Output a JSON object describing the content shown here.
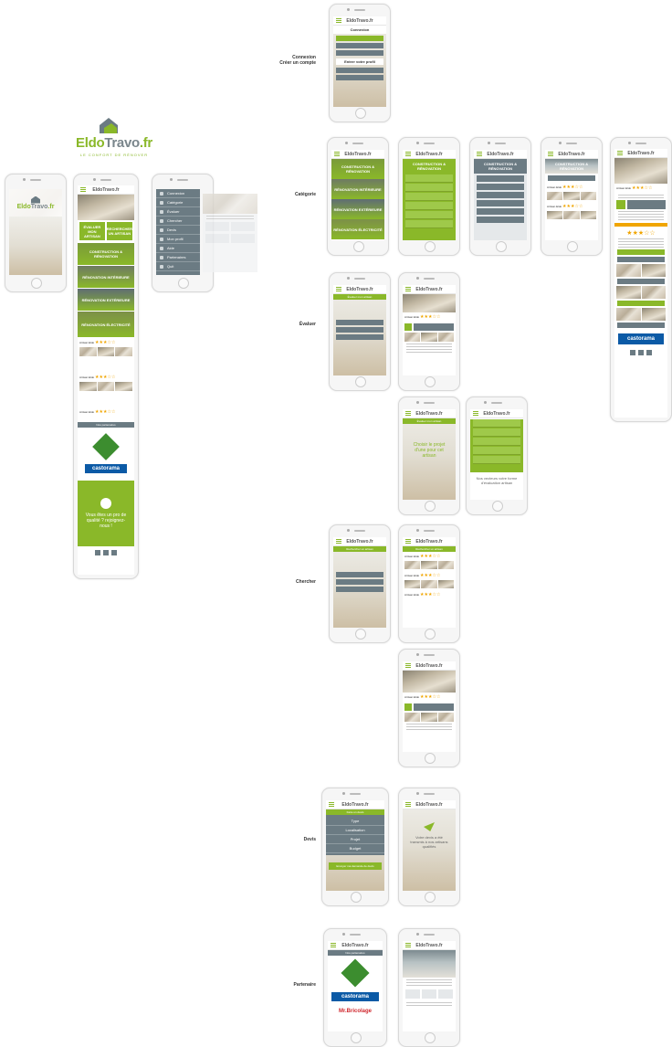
{
  "brand": {
    "logo_text_part1": "Eldo",
    "logo_text_part2": "Travo",
    "logo_text_suffix": ".fr",
    "tagline": "LE CONFORT DE RÉNOVER"
  },
  "app_header_title": "EldoTravo.fr",
  "section_labels": {
    "connexion": "Connexion",
    "creer_compte": "Créer un compte",
    "categorie": "Catégorie",
    "evaluer": "Évaluer",
    "chercher": "Chercher",
    "devis": "Devis",
    "partenaire": "Partenaire"
  },
  "connexion_screen": {
    "title": "Connexion",
    "button": "Entrer votre profil"
  },
  "home_screen": {
    "tiles": [
      "Construction & Rénovation",
      "Rénovation Intérieure",
      "Rénovation Extérieure",
      "Rénovation Électricité"
    ],
    "buttons": [
      "Évaluer mon artisan",
      "Rechercher un artisan"
    ],
    "partners_title": "Nos partenaires",
    "partners": [
      "LEROY MERLIN",
      "castorama"
    ],
    "cta": "Vous êtes un pro de qualité ? rejoignez-nous !"
  },
  "menu_screen": {
    "items": [
      "Connexion",
      "Catégorie",
      "Évaluer",
      "Chercher",
      "Devis",
      "Mon profil",
      "Aide",
      "Partenaires",
      "Quit"
    ]
  },
  "category_screen": {
    "tiles": [
      "Construction & Rénovation",
      "Rénovation Intérieure",
      "Rénovation Extérieure",
      "Rénovation Électricité"
    ]
  },
  "artisan": {
    "name": "Artisan Eldo",
    "rating_stars": "★★★☆☆"
  },
  "evaluer_screen": {
    "title": "Évaluer mon artisan",
    "empty_message": "Choisir le projet d'une pour cet artisan",
    "menu_footer": "Nos vecteurs votre forme d'évaluation artisan"
  },
  "chercher_screen": {
    "title": "Rechercher un artisan"
  },
  "devis_screen": {
    "title": "Faire un devis",
    "items": [
      "Type",
      "Localisation",
      "Projet",
      "Budget"
    ],
    "button": "Envoyer ma demande de devis",
    "confirm_message": "Votre devis a été transmis à nos artisans qualifiés"
  },
  "partenaire_screen": {
    "title": "Nos partenaires",
    "logos": [
      "LEROY MERLIN",
      "castorama",
      "Mr.Bricolage"
    ]
  },
  "detail_screen": {
    "partner": "castorama"
  },
  "colors": {
    "accent_green": "#8ab829",
    "slate": "#6b7b83",
    "dark_slate": "#4e5b61",
    "castorama_blue": "#0b5aa6",
    "leroy_green": "#3c8d2f",
    "star": "#f0a500"
  }
}
